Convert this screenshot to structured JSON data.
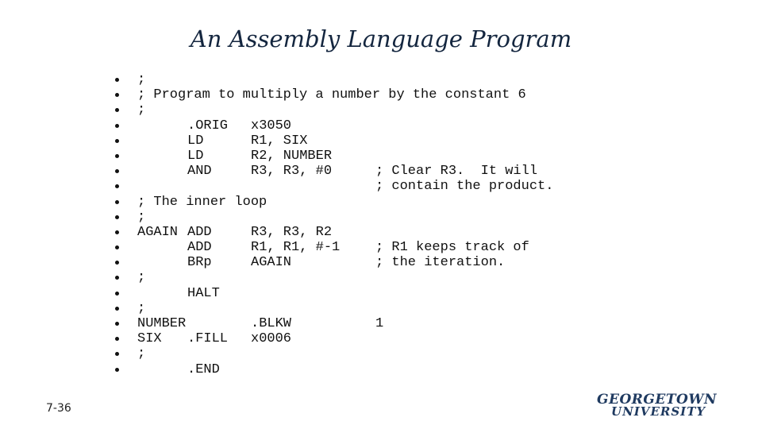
{
  "slide": {
    "title": "An Assembly Language Program",
    "slide_number": "7-36",
    "logo": {
      "line1": "GEORGETOWN",
      "line2": "UNIVERSITY"
    }
  },
  "code_lines": [
    {
      "label": ";",
      "op": "",
      "args": "",
      "comment": ""
    },
    {
      "label": "; Program to multiply a number by the constant 6",
      "op": "",
      "args": "",
      "comment": ""
    },
    {
      "label": ";",
      "op": "",
      "args": "",
      "comment": ""
    },
    {
      "label": "",
      "op": ".ORIG",
      "args": "x3050",
      "comment": ""
    },
    {
      "label": "",
      "op": "LD",
      "args": "R1, SIX",
      "comment": ""
    },
    {
      "label": "",
      "op": "LD",
      "args": "R2, NUMBER",
      "comment": ""
    },
    {
      "label": "",
      "op": "AND",
      "args": "R3, R3, #0",
      "comment": "; Clear R3.  It will"
    },
    {
      "label": "",
      "op": "",
      "args": "",
      "comment": "; contain the product."
    },
    {
      "label": "; The inner loop",
      "op": "",
      "args": "",
      "comment": ""
    },
    {
      "label": ";",
      "op": "",
      "args": "",
      "comment": ""
    },
    {
      "label": "AGAIN",
      "op": "ADD",
      "args": "R3, R3, R2",
      "comment": ""
    },
    {
      "label": "",
      "op": "ADD",
      "args": "R1, R1, #-1",
      "comment": "; R1 keeps track of"
    },
    {
      "label": "",
      "op": "BRp",
      "args": "AGAIN",
      "comment": "; the iteration."
    },
    {
      "label": ";",
      "op": "",
      "args": "",
      "comment": ""
    },
    {
      "label": "",
      "op": "HALT",
      "args": "",
      "comment": ""
    },
    {
      "label": ";",
      "op": "",
      "args": "",
      "comment": ""
    },
    {
      "label": "NUMBER",
      "op": "",
      "args": ".BLKW",
      "comment": "1"
    },
    {
      "label": "SIX",
      "op": ".FILL",
      "args": "x0006",
      "comment": ""
    },
    {
      "label": ";",
      "op": "",
      "args": "",
      "comment": ""
    },
    {
      "label": "",
      "op": ".END",
      "args": "",
      "comment": ""
    }
  ],
  "colors": {
    "title": "#14263f",
    "logo": "#1f3a60",
    "text": "#111111"
  }
}
